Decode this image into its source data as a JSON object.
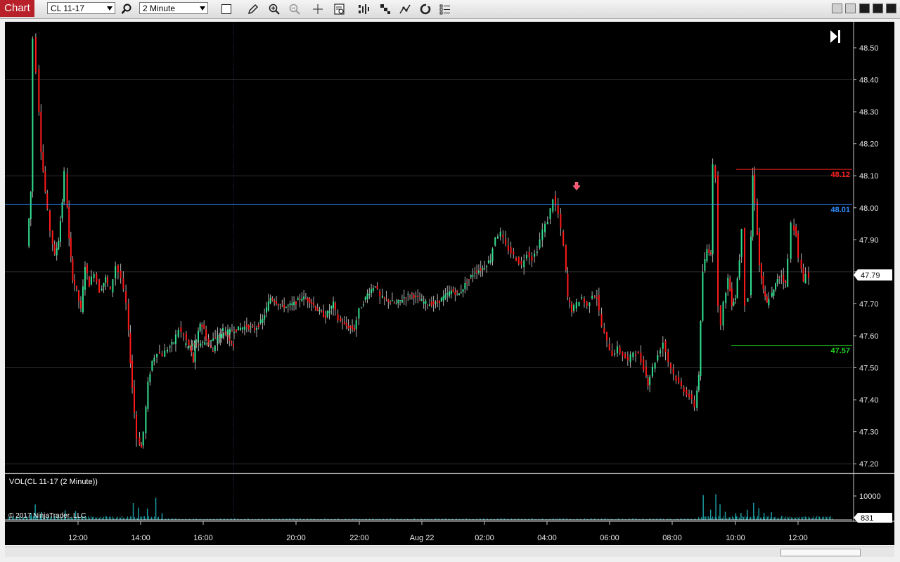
{
  "toolbar": {
    "tab_label": "Chart",
    "instrument": "CL 11-17",
    "interval": "2 Minute",
    "icons": [
      "search-icon",
      "bar-type-icon",
      "draw-icon",
      "zoom-in-icon",
      "zoom-out-icon",
      "crosshair-icon",
      "data-box-icon",
      "indicators-icon",
      "strategies-icon",
      "drawing-tools-icon",
      "reload-icon",
      "properties-icon"
    ]
  },
  "window_buttons": [
    "restore-icon",
    "restore-icon",
    "minimize-icon",
    "maximize-icon",
    "close-icon"
  ],
  "colors": {
    "background": "#000000",
    "up": "#33e090",
    "down": "#ff1a1a",
    "wick": "#b0b0b0",
    "volume": "#1a9aa0",
    "level_high": "#ff2020",
    "level_mid": "#2f8fff",
    "level_low": "#22d022",
    "grid": "#2d2d2d",
    "axis_text": "#e8e8e8"
  },
  "chart_data": {
    "type": "candlestick",
    "instrument": "CL 11-17",
    "interval": "2 Minute",
    "ylim": [
      47.18,
      48.57
    ],
    "yticks": [
      "48.50",
      "48.40",
      "48.30",
      "48.20",
      "48.10",
      "48.00",
      "47.90",
      "47.80",
      "47.70",
      "47.60",
      "47.50",
      "47.40",
      "47.30",
      "47.20"
    ],
    "xticks": [
      "12:00",
      "14:00",
      "16:00",
      "20:00",
      "22:00",
      "Aug 22",
      "02:00",
      "04:00",
      "06:00",
      "08:00",
      "10:00",
      "12:00"
    ],
    "last_price": "47.79",
    "levels": [
      {
        "label": "48.12",
        "value": 48.12,
        "color": "#ff2020"
      },
      {
        "label": "48.01",
        "value": 48.01,
        "color": "#2f8fff"
      },
      {
        "label": "47.57",
        "value": 47.57,
        "color": "#22d022"
      }
    ],
    "marker": {
      "type": "down-arrow",
      "time": "04:58",
      "value": 48.06
    },
    "price_path": [
      [
        "10:25",
        47.88
      ],
      [
        "10:32",
        48.05
      ],
      [
        "10:38",
        48.53
      ],
      [
        "10:44",
        48.43
      ],
      [
        "10:52",
        48.18
      ],
      [
        "11:00",
        48.05
      ],
      [
        "11:10",
        47.93
      ],
      [
        "11:18",
        47.85
      ],
      [
        "11:25",
        47.9
      ],
      [
        "11:32",
        48.02
      ],
      [
        "11:38",
        48.11
      ],
      [
        "11:45",
        47.9
      ],
      [
        "11:52",
        47.78
      ],
      [
        "12:00",
        47.74
      ],
      [
        "12:08",
        47.68
      ],
      [
        "12:16",
        47.82
      ],
      [
        "12:24",
        47.76
      ],
      [
        "12:34",
        47.8
      ],
      [
        "12:44",
        47.74
      ],
      [
        "12:55",
        47.78
      ],
      [
        "13:05",
        47.74
      ],
      [
        "13:15",
        47.82
      ],
      [
        "13:25",
        47.78
      ],
      [
        "13:35",
        47.7
      ],
      [
        "13:42",
        47.52
      ],
      [
        "13:50",
        47.36
      ],
      [
        "13:56",
        47.28
      ],
      [
        "14:03",
        47.25
      ],
      [
        "14:08",
        47.3
      ],
      [
        "14:16",
        47.45
      ],
      [
        "14:24",
        47.52
      ],
      [
        "14:34",
        47.55
      ],
      [
        "14:44",
        47.54
      ],
      [
        "14:54",
        47.56
      ],
      [
        "15:05",
        47.58
      ],
      [
        "15:15",
        47.62
      ],
      [
        "15:25",
        47.6
      ],
      [
        "15:35",
        47.57
      ],
      [
        "15:42",
        47.52
      ],
      [
        "15:48",
        47.58
      ],
      [
        "15:55",
        47.64
      ],
      [
        "16:03",
        47.62
      ],
      [
        "16:12",
        47.57
      ],
      [
        "16:20",
        47.55
      ],
      [
        "16:30",
        47.6
      ],
      [
        "16:40",
        47.62
      ],
      [
        "16:55",
        47.58
      ],
      [
        "17:10",
        47.57
      ],
      [
        "17:30",
        47.57
      ],
      [
        "17:50",
        47.58
      ],
      [
        "18:10",
        47.59
      ],
      [
        "18:30",
        47.61
      ],
      [
        "18:50",
        47.62
      ],
      [
        "19:10",
        47.63
      ],
      [
        "19:25",
        47.62
      ],
      [
        "19:40",
        47.65
      ],
      [
        "19:55",
        47.72
      ],
      [
        "20:10",
        47.7
      ],
      [
        "20:25",
        47.69
      ],
      [
        "20:40",
        47.7
      ],
      [
        "20:55",
        47.72
      ],
      [
        "21:10",
        47.71
      ],
      [
        "21:25",
        47.68
      ],
      [
        "21:40",
        47.66
      ],
      [
        "21:55",
        47.7
      ],
      [
        "22:05",
        47.65
      ],
      [
        "22:20",
        47.63
      ],
      [
        "22:35",
        47.62
      ],
      [
        "22:45",
        47.68
      ],
      [
        "23:00",
        47.73
      ],
      [
        "23:15",
        47.76
      ],
      [
        "23:25",
        47.72
      ],
      [
        "23:40",
        47.71
      ],
      [
        "23:55",
        47.7
      ],
      [
        "00:10",
        47.72
      ],
      [
        "00:25",
        47.73
      ],
      [
        "00:40",
        47.71
      ],
      [
        "00:55",
        47.7
      ],
      [
        "01:10",
        47.7
      ],
      [
        "01:25",
        47.72
      ],
      [
        "01:40",
        47.74
      ],
      [
        "01:55",
        47.73
      ],
      [
        "02:10",
        47.77
      ],
      [
        "02:25",
        47.8
      ],
      [
        "02:40",
        47.81
      ],
      [
        "02:55",
        47.84
      ],
      [
        "03:05",
        47.91
      ],
      [
        "03:15",
        47.92
      ],
      [
        "03:25",
        47.88
      ],
      [
        "03:35",
        47.86
      ],
      [
        "03:45",
        47.84
      ],
      [
        "03:55",
        47.82
      ],
      [
        "04:05",
        47.86
      ],
      [
        "04:15",
        47.84
      ],
      [
        "04:25",
        47.87
      ],
      [
        "04:35",
        47.93
      ],
      [
        "04:45",
        47.96
      ],
      [
        "04:55",
        48.03
      ],
      [
        "05:05",
        47.98
      ],
      [
        "05:15",
        47.88
      ],
      [
        "05:22",
        47.72
      ],
      [
        "05:30",
        47.68
      ],
      [
        "05:40",
        47.7
      ],
      [
        "05:50",
        47.72
      ],
      [
        "06:00",
        47.69
      ],
      [
        "06:10",
        47.73
      ],
      [
        "06:18",
        47.72
      ],
      [
        "06:28",
        47.63
      ],
      [
        "06:38",
        47.58
      ],
      [
        "06:48",
        47.54
      ],
      [
        "06:58",
        47.56
      ],
      [
        "07:08",
        47.54
      ],
      [
        "07:18",
        47.52
      ],
      [
        "07:28",
        47.55
      ],
      [
        "07:38",
        47.54
      ],
      [
        "07:48",
        47.5
      ],
      [
        "07:55",
        47.45
      ],
      [
        "08:05",
        47.5
      ],
      [
        "08:15",
        47.54
      ],
      [
        "08:25",
        47.58
      ],
      [
        "08:35",
        47.52
      ],
      [
        "08:45",
        47.48
      ],
      [
        "08:55",
        47.45
      ],
      [
        "09:05",
        47.43
      ],
      [
        "09:15",
        47.41
      ],
      [
        "09:25",
        47.38
      ],
      [
        "09:32",
        47.48
      ],
      [
        "09:40",
        47.8
      ],
      [
        "09:48",
        47.87
      ],
      [
        "09:55",
        47.86
      ],
      [
        "10:00",
        48.13
      ],
      [
        "10:05",
        48.1
      ],
      [
        "10:10",
        47.7
      ],
      [
        "10:15",
        47.63
      ],
      [
        "10:20",
        47.7
      ],
      [
        "10:28",
        47.78
      ],
      [
        "10:35",
        47.7
      ],
      [
        "10:42",
        47.72
      ],
      [
        "10:50",
        47.84
      ],
      [
        "10:56",
        47.94
      ],
      [
        "11:02",
        47.7
      ],
      [
        "11:08",
        47.72
      ],
      [
        "11:15",
        48.1
      ],
      [
        "11:20",
        48.02
      ],
      [
        "11:28",
        47.82
      ],
      [
        "11:35",
        47.74
      ],
      [
        "11:42",
        47.7
      ],
      [
        "11:48",
        47.72
      ],
      [
        "11:55",
        47.74
      ],
      [
        "12:02",
        47.78
      ],
      [
        "12:10",
        47.79
      ],
      [
        "12:18",
        47.76
      ],
      [
        "12:24",
        47.84
      ],
      [
        "12:30",
        47.95
      ],
      [
        "12:38",
        47.92
      ],
      [
        "12:44",
        47.84
      ],
      [
        "12:52",
        47.77
      ],
      [
        "12:58",
        47.8
      ],
      [
        "13:04",
        47.78
      ]
    ],
    "volume": {
      "label": "VOL(CL 11-17 (2 Minute))",
      "yticks": [
        "10000"
      ],
      "last": "831",
      "bars": [
        [
          "10:30",
          3000
        ],
        [
          "10:38",
          6800
        ],
        [
          "10:50",
          3500
        ],
        [
          "11:35",
          4200
        ],
        [
          "11:55",
          3900
        ],
        [
          "13:45",
          7500
        ],
        [
          "13:55",
          5400
        ],
        [
          "14:12",
          5000
        ],
        [
          "14:28",
          9800
        ],
        [
          "14:40",
          3000
        ],
        [
          "09:38",
          11000
        ],
        [
          "09:52",
          4500
        ],
        [
          "10:02",
          11400
        ],
        [
          "10:10",
          7000
        ],
        [
          "10:20",
          3600
        ],
        [
          "10:40",
          3000
        ],
        [
          "10:50",
          3100
        ],
        [
          "11:02",
          4500
        ],
        [
          "11:14",
          7600
        ],
        [
          "11:24",
          5200
        ],
        [
          "11:34",
          3100
        ],
        [
          "11:48",
          3400
        ]
      ]
    },
    "copyright": "© 2017 NinjaTrader, LLC"
  }
}
